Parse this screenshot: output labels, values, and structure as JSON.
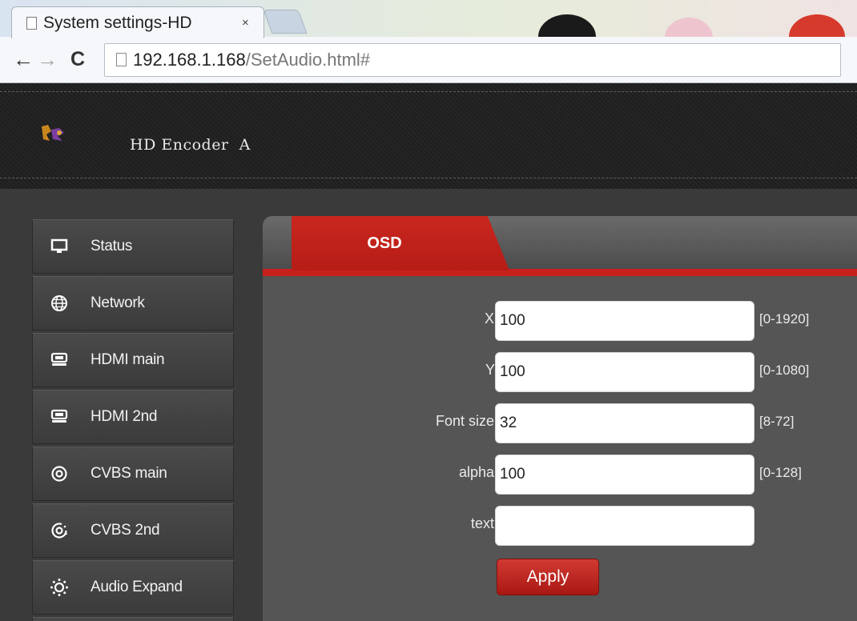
{
  "browser": {
    "tab_title": "System settings-HD",
    "tab_close": "×",
    "url_host": "192.168.1.168",
    "url_path": "/SetAudio.html#",
    "back_glyph": "←",
    "forward_glyph": "→",
    "reload_glyph": "C"
  },
  "header": {
    "brand": "HD Encoder  A"
  },
  "sidebar": {
    "items": [
      {
        "label": "Status",
        "icon": "monitor-icon"
      },
      {
        "label": "Network",
        "icon": "globe-icon"
      },
      {
        "label": "HDMI main",
        "icon": "hdmi-icon"
      },
      {
        "label": "HDMI 2nd",
        "icon": "hdmi-icon"
      },
      {
        "label": "CVBS main",
        "icon": "target-icon"
      },
      {
        "label": "CVBS 2nd",
        "icon": "target-dotted-icon"
      },
      {
        "label": "Audio Expand",
        "icon": "sun-icon"
      }
    ]
  },
  "main": {
    "tab_label": "OSD",
    "fields": [
      {
        "label": "X:",
        "value": "100",
        "range": "[0-1920]"
      },
      {
        "label": "Y:",
        "value": "100",
        "range": "[0-1080]"
      },
      {
        "label": "Font size:",
        "value": "32",
        "range": "[8-72]"
      },
      {
        "label": "alpha:",
        "value": "100",
        "range": "[0-128]"
      },
      {
        "label": "text:",
        "value": "",
        "range": ""
      }
    ],
    "apply_label": "Apply"
  },
  "colors": {
    "accent_red": "#c8201b",
    "panel_gray": "#555555",
    "header_black": "#222222"
  }
}
